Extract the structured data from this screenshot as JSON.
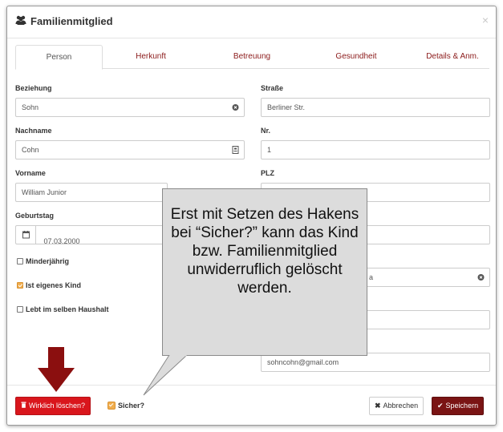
{
  "modal": {
    "title": "Familienmitglied",
    "title_icon": "users-icon",
    "close_label": "×"
  },
  "tabs": [
    {
      "label": "Person",
      "active": true
    },
    {
      "label": "Herkunft",
      "active": false
    },
    {
      "label": "Betreuung",
      "active": false
    },
    {
      "label": "Gesundheit",
      "active": false
    },
    {
      "label": "Details & Anm.",
      "active": false
    }
  ],
  "left": {
    "beziehung_label": "Beziehung",
    "beziehung_value": "Sohn",
    "nachname_label": "Nachname",
    "nachname_value": "Cohn",
    "vorname_label": "Vorname",
    "vorname_value": "William Junior",
    "geburtstag_label": "Geburtstag",
    "geburtstag_value": "07.03.2000",
    "minderjaehrig_label": "Minderjährig",
    "minderjaehrig_checked": false,
    "eigenes_kind_label": "Ist eigenes Kind",
    "eigenes_kind_checked": true,
    "haushalt_label": "Lebt im selben Haushalt",
    "haushalt_checked": false
  },
  "right": {
    "strasse_label": "Straße",
    "strasse_value": "Berliner Str.",
    "nr_label": "Nr.",
    "nr_value": "1",
    "plz_label": "PLZ",
    "land_partial": "a",
    "email_value": "sohncohn@gmail.com"
  },
  "footer": {
    "delete_label": "Wirklich löschen?",
    "sicher_label": "Sicher?",
    "sicher_checked": true,
    "cancel_label": "Abbrechen",
    "save_label": "Speichern"
  },
  "callout": {
    "text": "Erst mit Setzen des Hakens bei “Sicher?” kann das Kind bzw. Familienmitglied unwiderruflich gelöscht werden."
  },
  "colors": {
    "danger": "#d9161c",
    "primary": "#7a1414",
    "tab_link": "#8b1a1a",
    "arrow": "#8b0f0f",
    "checkbox_checked": "#f0ad4e"
  }
}
